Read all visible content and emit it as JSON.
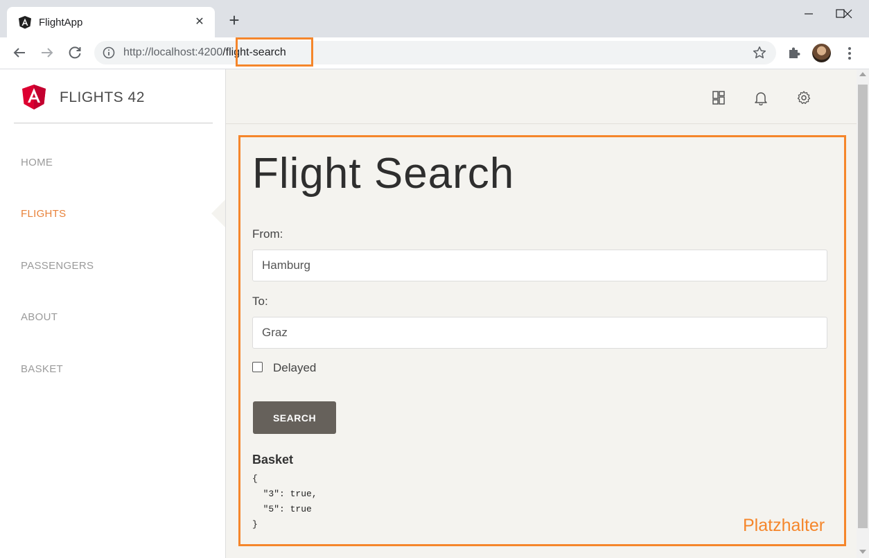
{
  "browser": {
    "tab_title": "FlightApp",
    "url_host": "http://localhost:4200",
    "url_path": "/flight-search"
  },
  "sidebar": {
    "brand": "FLIGHTS 42",
    "items": [
      {
        "label": "HOME",
        "active": false
      },
      {
        "label": "FLIGHTS",
        "active": true
      },
      {
        "label": "PASSENGERS",
        "active": false
      },
      {
        "label": "ABOUT",
        "active": false
      },
      {
        "label": "BASKET",
        "active": false
      }
    ]
  },
  "topbar": {
    "icons": [
      "dashboard-icon",
      "bell-icon",
      "gear-icon"
    ]
  },
  "search": {
    "title": "Flight Search",
    "from_label": "From:",
    "from_value": "Hamburg",
    "to_label": "To:",
    "to_value": "Graz",
    "delayed_label": "Delayed",
    "delayed_checked": false,
    "button_label": "SEARCH"
  },
  "basket": {
    "heading": "Basket",
    "json_text": "{\n  \"3\": true,\n  \"5\": true\n}"
  },
  "annotation": {
    "placeholder_label": "Platzhalter"
  },
  "colors": {
    "accent": "#e8823a",
    "highlight": "#f5862b",
    "button": "#66615b",
    "main_bg": "#f4f3ef"
  }
}
